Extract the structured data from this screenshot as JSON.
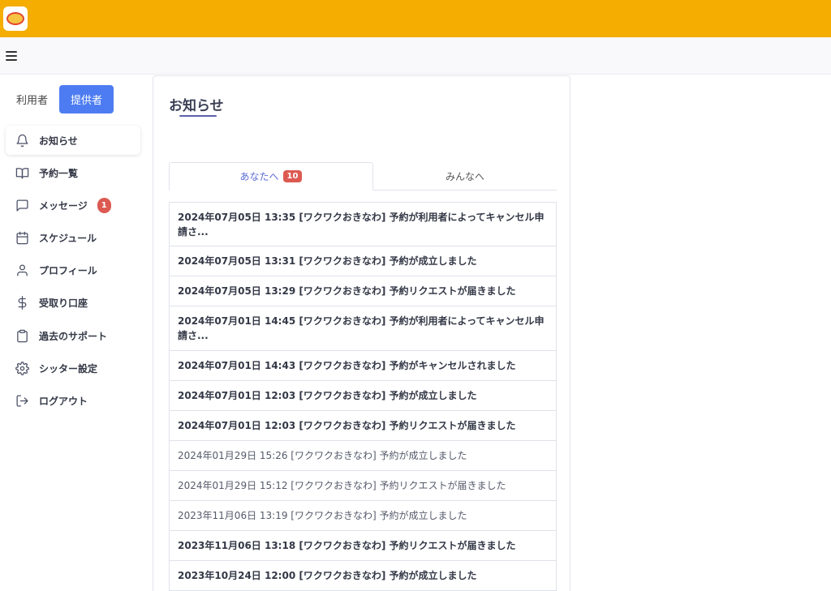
{
  "header": {
    "logo_icon": "wakuwaku-logo-icon",
    "color": "#f4ad00"
  },
  "sidebar": {
    "role_user": "利用者",
    "role_provider": "提供者",
    "items": [
      {
        "label": "お知らせ",
        "icon": "bell-icon"
      },
      {
        "label": "予約一覧",
        "icon": "book-icon"
      },
      {
        "label": "メッセージ",
        "icon": "message-icon",
        "badge": "1"
      },
      {
        "label": "スケジュール",
        "icon": "calendar-icon"
      },
      {
        "label": "プロフィール",
        "icon": "user-icon"
      },
      {
        "label": "受取り口座",
        "icon": "dollar-icon"
      },
      {
        "label": "過去のサポート",
        "icon": "clipboard-icon"
      },
      {
        "label": "シッター設定",
        "icon": "gear-icon"
      },
      {
        "label": "ログアウト",
        "icon": "logout-icon"
      }
    ]
  },
  "main": {
    "title": "お知らせ",
    "tabs": [
      {
        "label": "あなたへ",
        "badge": "10"
      },
      {
        "label": "みんなへ"
      }
    ],
    "notices": [
      "2024年07月05日 13:35 [ワクワクおきなわ] 予約が利用者によってキャンセル申請さ...",
      "2024年07月05日 13:31 [ワクワクおきなわ] 予約が成立しました",
      "2024年07月05日 13:29 [ワクワクおきなわ] 予約リクエストが届きました",
      "2024年07月01日 14:45 [ワクワクおきなわ] 予約が利用者によってキャンセル申請さ...",
      "2024年07月01日 14:43 [ワクワクおきなわ] 予約がキャンセルされました",
      "2024年07月01日 12:03 [ワクワクおきなわ] 予約が成立しました",
      "2024年07月01日 12:03 [ワクワクおきなわ] 予約リクエストが届きました",
      "2024年01月29日 15:26 [ワクワクおきなわ] 予約が成立しました",
      "2024年01月29日 15:12 [ワクワクおきなわ] 予約リクエストが届きました",
      "2023年11月06日 13:19 [ワクワクおきなわ] 予約が成立しました",
      "2023年11月06日 13:18 [ワクワクおきなわ] 予約リクエストが届きました",
      "2023年10月24日 12:00 [ワクワクおきなわ] 予約が成立しました"
    ]
  },
  "colors": {
    "accent": "#4d7cf2",
    "badge": "#dc5a52",
    "tab_active": "#5b6bd6"
  }
}
